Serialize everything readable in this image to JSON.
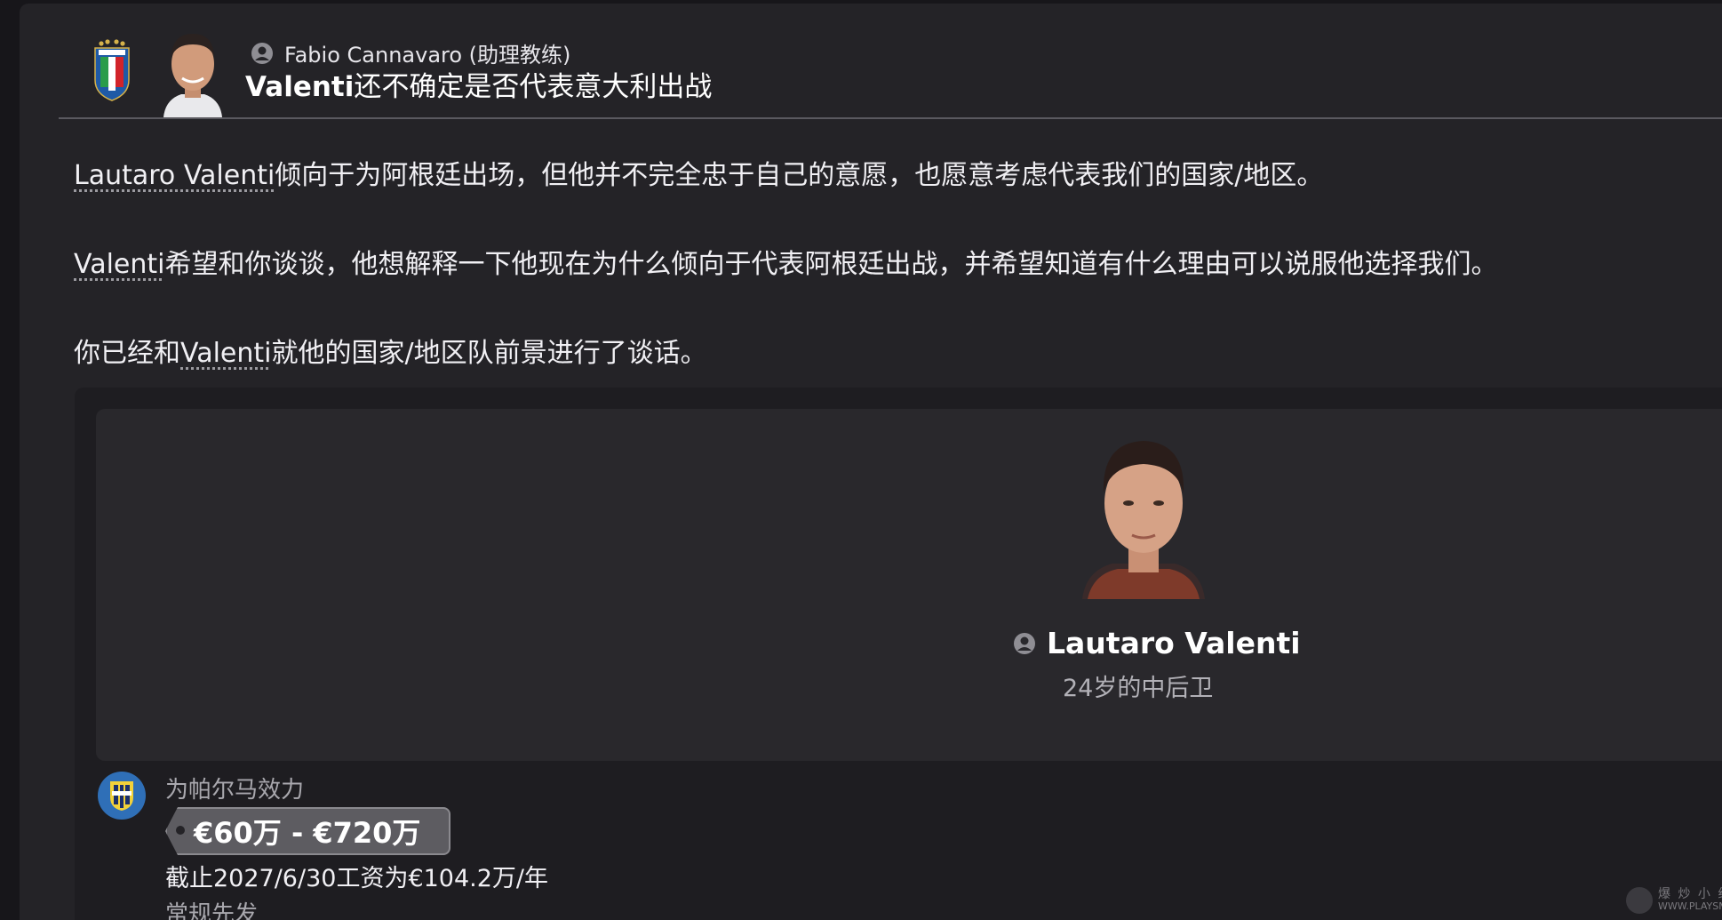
{
  "header": {
    "sender": "Fabio Cannavaro (助理教练)",
    "subject_bold": "Valenti",
    "subject_rest": "还不确定是否代表意大利出战"
  },
  "body": {
    "p1_link": "Lautaro Valenti",
    "p1_rest": "倾向于为阿根廷出场，但他并不完全忠于自己的意愿，也愿意考虑代表我们的国家/地区。",
    "p2_link": "Valenti",
    "p2_rest": "希望和你谈谈，他想解释一下他现在为什么倾向于代表阿根廷出战，并希望知道有什么理由可以说服他选择我们。",
    "p3_pre": "你已经和",
    "p3_link": "Valenti",
    "p3_rest": "就他的国家/地区队前景进行了谈话。"
  },
  "player": {
    "name": "Lautaro Valenti",
    "age_position": "24岁的中后卫",
    "club_line": "为帕尔马效力",
    "value_range": "€60万 - €720万",
    "wage": "截止2027/6/30工资为€104.2万/年",
    "status": "常规先发"
  },
  "watermark": {
    "title": "爆 炒 小 组",
    "url": "WWW.PLAYSM.CC"
  },
  "colors": {
    "background": "#242327",
    "card": "#29282c",
    "club_badge": "#2f6fb7",
    "italy_green": "#2a9c4a",
    "italy_red": "#d2232a",
    "italy_blue": "#1f5aa6"
  }
}
